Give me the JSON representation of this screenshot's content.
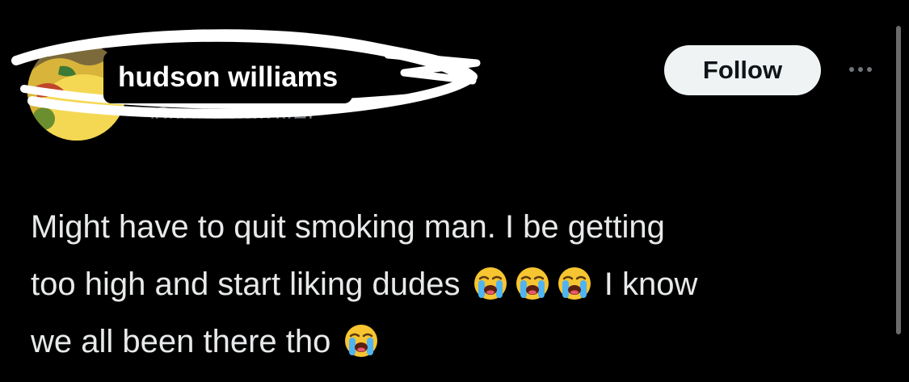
{
  "user": {
    "display_name": "hudson williams",
    "handle": "@tonystatover"
  },
  "actions": {
    "follow_label": "Follow",
    "more_icon": "more-horizontal-icon"
  },
  "tweet": {
    "line1": "Might have to quit smoking man. I be getting",
    "line2_a": "too high and start liking dudes",
    "line2_b": "I know",
    "line3": "we all been there tho",
    "emoji_name": "loudly-crying-face-icon"
  },
  "colors": {
    "background": "#000000",
    "text": "#e7e9ea",
    "follow_bg": "#eff3f4",
    "muted": "#71767b"
  }
}
